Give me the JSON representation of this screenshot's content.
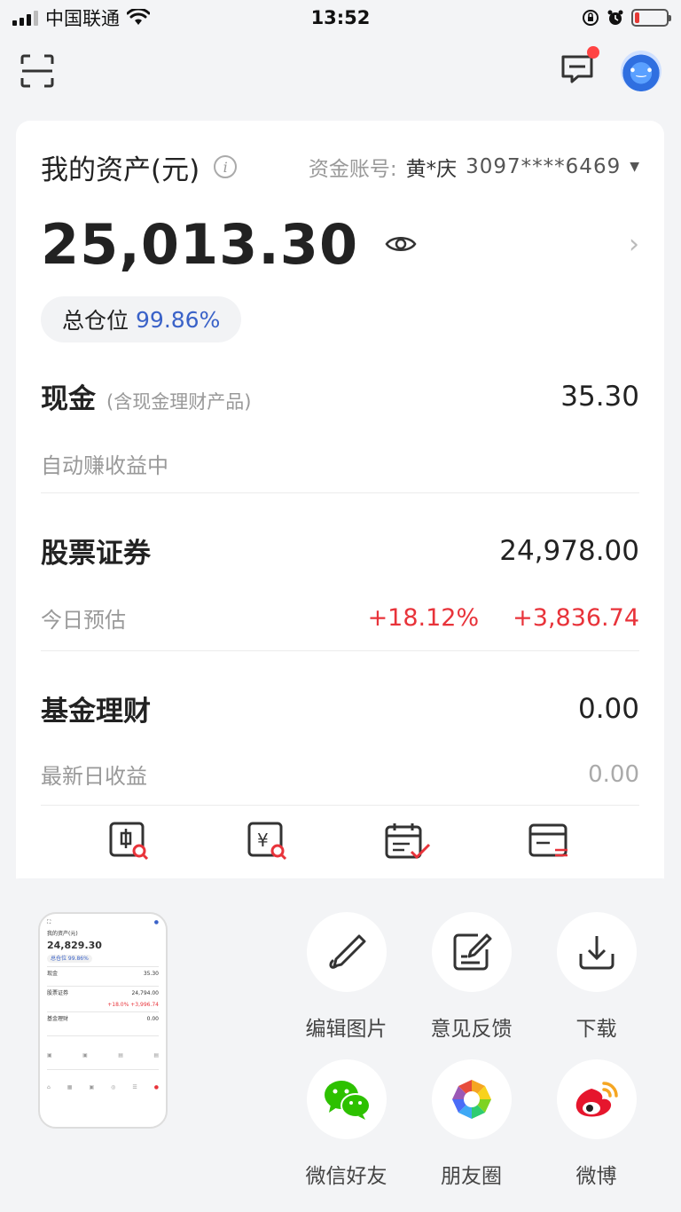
{
  "status_bar": {
    "carrier": "中国联通",
    "time": "13:52"
  },
  "header": {
    "scan_icon": "scan-icon",
    "message_icon": "message-icon",
    "assistant_icon": "robot-avatar"
  },
  "assets": {
    "title": "我的资产(元)",
    "account_label": "资金账号:",
    "account_name": "黄*庆",
    "account_number": "3097****6469",
    "total": "25,013.30",
    "position_label": "总仓位",
    "position_value": "99.86%"
  },
  "sections": {
    "cash": {
      "name": "现金",
      "note": "(含现金理财产品)",
      "value": "35.30",
      "sub_label": "自动赚收益中"
    },
    "stocks": {
      "name": "股票证券",
      "value": "24,978.00",
      "sub_label": "今日预估",
      "change_pct": "+18.12%",
      "change_amt": "+3,836.74"
    },
    "funds": {
      "name": "基金理财",
      "value": "0.00",
      "sub_label": "最新日收益",
      "sub_value": "0.00"
    }
  },
  "share": {
    "actions": [
      {
        "label": "编辑图片",
        "icon": "pen-icon"
      },
      {
        "label": "意见反馈",
        "icon": "feedback-icon"
      },
      {
        "label": "下载",
        "icon": "download-icon"
      },
      {
        "label": "微信好友",
        "icon": "wechat-icon"
      },
      {
        "label": "朋友圈",
        "icon": "moments-icon"
      },
      {
        "label": "微博",
        "icon": "weibo-icon"
      }
    ]
  },
  "thumbnail": {
    "title": "我的资产(元)",
    "total": "24,829.30",
    "position": "总仓位 99.86%",
    "cash_label": "现金",
    "cash_value": "35.30",
    "stock_label": "股票证券",
    "stock_value": "24,794.00",
    "stock_change_pct": "+18.0%",
    "stock_change_amt": "+3,996.74",
    "fund_label": "基金理财",
    "fund_value": "0.00"
  },
  "colors": {
    "accent_blue": "#3a62c8",
    "up_red": "#e8333a",
    "background": "#f3f4f6"
  }
}
